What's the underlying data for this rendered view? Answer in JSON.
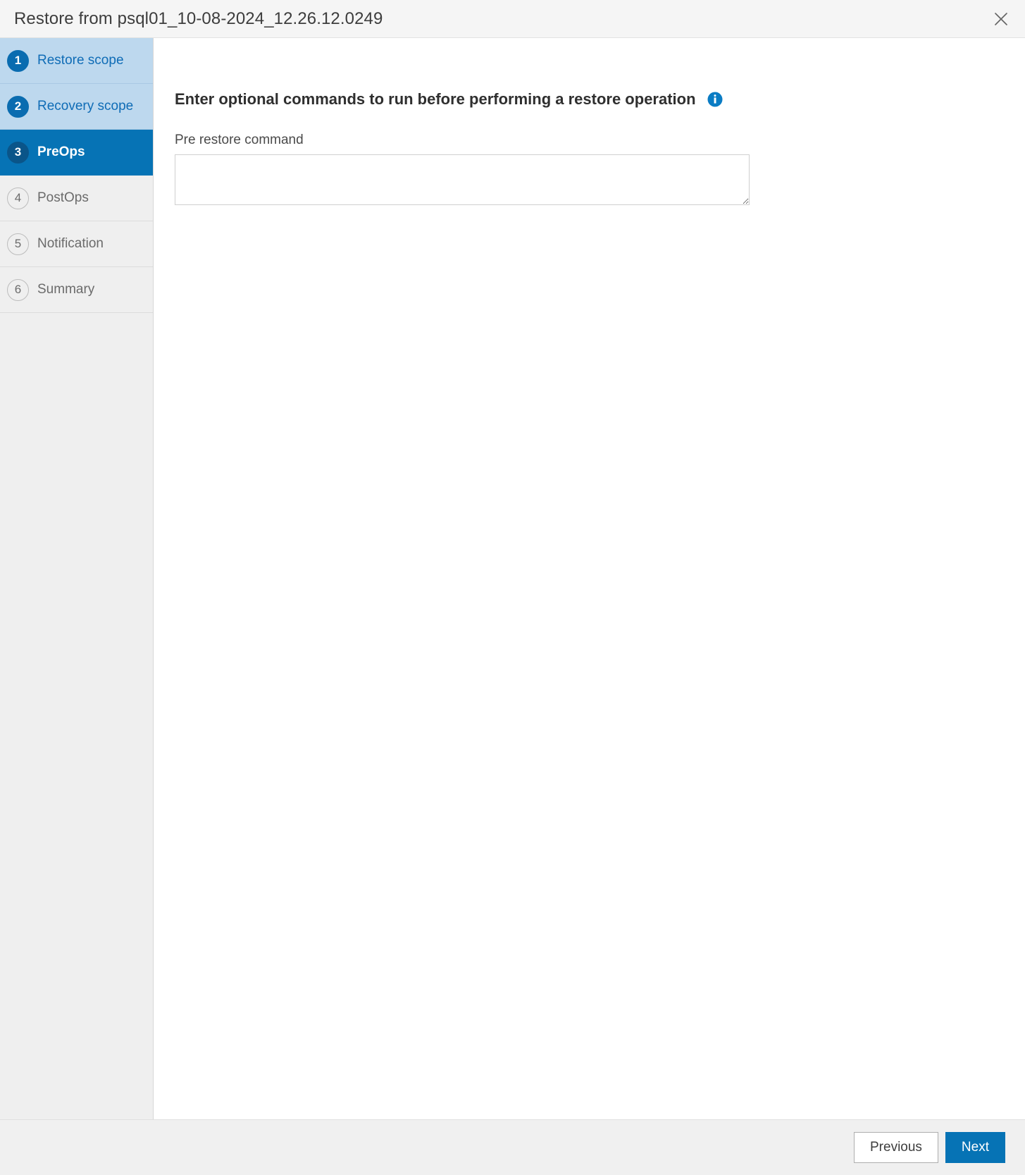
{
  "dialog": {
    "title": "Restore from psql01_10-08-2024_12.26.12.0249",
    "close_icon": "close-icon"
  },
  "sidebar": {
    "steps": [
      {
        "number": "1",
        "label": "Restore scope",
        "state": "done"
      },
      {
        "number": "2",
        "label": "Recovery scope",
        "state": "done"
      },
      {
        "number": "3",
        "label": "PreOps",
        "state": "active"
      },
      {
        "number": "4",
        "label": "PostOps",
        "state": "pending"
      },
      {
        "number": "5",
        "label": "Notification",
        "state": "pending"
      },
      {
        "number": "6",
        "label": "Summary",
        "state": "pending"
      }
    ]
  },
  "main": {
    "heading": "Enter optional commands to run before performing a restore operation",
    "info_icon": "info-icon",
    "field": {
      "label": "Pre restore command",
      "value": "",
      "placeholder": ""
    }
  },
  "footer": {
    "previous_label": "Previous",
    "next_label": "Next"
  },
  "colors": {
    "accent": "#0673b5",
    "accent_dark": "#0a5589",
    "step_done_bg": "#bdd8ee",
    "sidebar_bg": "#efefef",
    "titlebar_bg": "#f5f5f5",
    "footer_bg": "#f0f0f0"
  }
}
